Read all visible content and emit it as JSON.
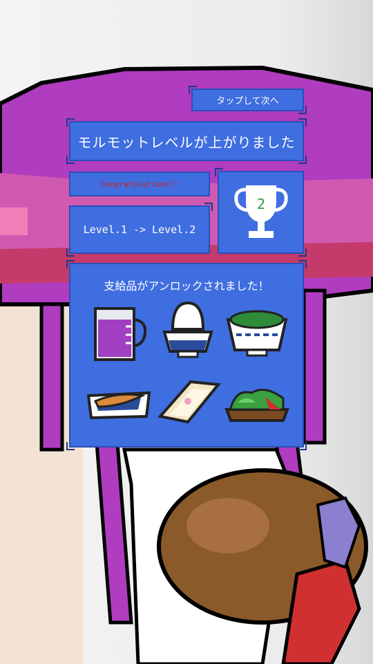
{
  "next_button": {
    "label": "タップして次へ"
  },
  "level_up_title": "モルモットレベルが上がりました",
  "congrats": "Congratulations!!",
  "level_change": "Level.1 -> Level.2",
  "trophy": {
    "icon": "trophy-icon",
    "number": "2"
  },
  "unlock_title": "支給品がアンロックされました！",
  "unlocked_items": [
    {
      "icon": "measuring-cup-icon"
    },
    {
      "icon": "rice-bowl-icon"
    },
    {
      "icon": "salad-bowl-icon"
    },
    {
      "icon": "carrot-tray-icon"
    },
    {
      "icon": "bread-board-icon"
    },
    {
      "icon": "lettuce-plate-icon"
    }
  ],
  "colors": {
    "panel": "#3f6ee0",
    "panel_border": "#2a4fb8",
    "congrats_text": "#d81b1b",
    "hat": "#b03cc0",
    "potato": "#8b5a2b"
  }
}
